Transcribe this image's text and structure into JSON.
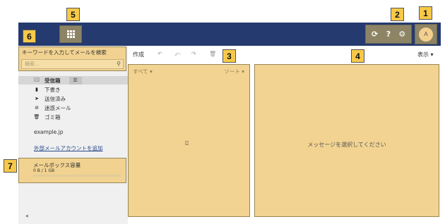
{
  "callouts": {
    "c1": "1",
    "c2": "2",
    "c3": "3",
    "c4": "4",
    "c5": "5",
    "c6": "6",
    "c7": "7"
  },
  "colors": {
    "header": "#253a6e",
    "highlight": "#f0cd82",
    "sidebar": "#f0f0f0"
  },
  "header": {
    "tools": {
      "refresh_icon": "⟳",
      "help_icon": "?",
      "settings_icon": "⚙"
    },
    "avatar_initial": "A"
  },
  "search": {
    "label": "キーワードを入力してメールを検索",
    "placeholder": "検索...",
    "icon": "search-icon"
  },
  "folders": [
    {
      "icon": "inbox-icon",
      "glyph": "🖂",
      "label": "受信箱"
    },
    {
      "icon": "draft-icon",
      "glyph": "▮",
      "label": "下書き"
    },
    {
      "icon": "sent-icon",
      "glyph": "➤",
      "label": "送信済み"
    },
    {
      "icon": "spam-icon",
      "glyph": "⊘",
      "label": "迷惑メール"
    },
    {
      "icon": "trash-icon",
      "glyph": "🗑",
      "label": "ゴミ箱"
    }
  ],
  "account_domain": "example.jp",
  "add_account_link": "外部メールアカウントを追加",
  "quota": {
    "title": "メールボックス容量",
    "value": "0 B / 1 GB",
    "fraction": 0
  },
  "collapse_glyph": "«",
  "toolbar": {
    "compose": "作成",
    "reply_icon": "↶",
    "reply_all_icon": "⤺",
    "forward_icon": "↷",
    "delete_icon": "🗑",
    "view_label": "表示 ▾"
  },
  "list": {
    "filter": "すべて ▾",
    "sort": "ソート ▾",
    "empty_icon": "⌼"
  },
  "message_view": {
    "placeholder": "メッセージを選択してください"
  }
}
